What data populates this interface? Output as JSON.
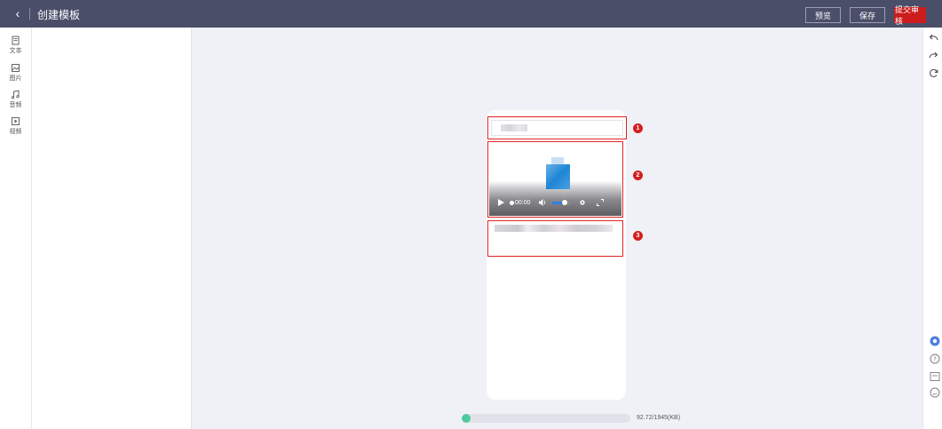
{
  "header": {
    "title": "创建模板",
    "preview_label": "预览",
    "save_label": "保存",
    "submit_label": "提交审核",
    "back_glyph": "‹"
  },
  "left_rail": {
    "items": [
      {
        "label": "文本",
        "icon": "text-icon"
      },
      {
        "label": "图片",
        "icon": "image-icon"
      },
      {
        "label": "音频",
        "icon": "audio-icon"
      },
      {
        "label": "视频",
        "icon": "video-icon"
      }
    ]
  },
  "right_rail": {
    "icons": [
      "undo-icon",
      "redo-icon",
      "refresh-icon"
    ]
  },
  "canvas": {
    "markers": [
      "1",
      "2",
      "3"
    ],
    "video": {
      "time": "00:00",
      "volume_fraction": 0.7
    }
  },
  "storage": {
    "used_kb": 92.72,
    "total_kb": 1945,
    "text": "92.72/1945(KB)"
  },
  "colors": {
    "header_bg": "#4a4e69",
    "submit_bg": "#cc1c1c",
    "selection_border": "#e02424",
    "progress_fill": "#4ecb9b"
  }
}
